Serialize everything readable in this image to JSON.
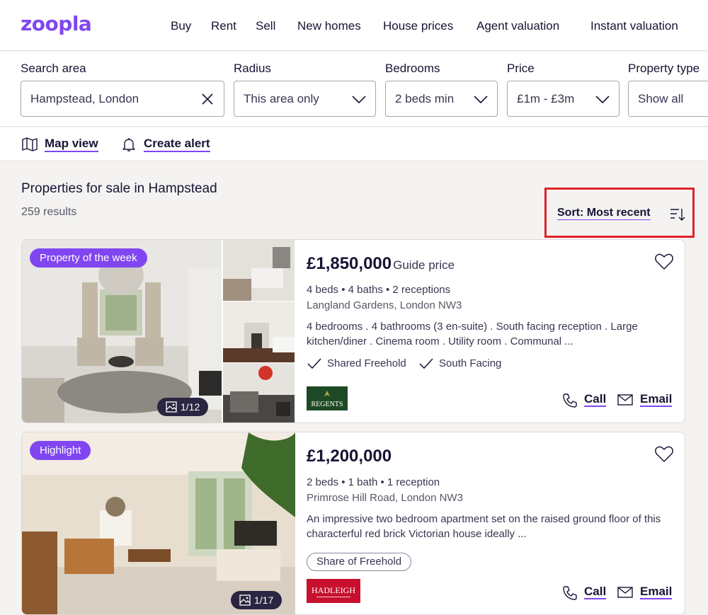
{
  "header": {
    "logo": "ZOOPLA",
    "nav": [
      "Buy",
      "Rent",
      "Sell",
      "New homes",
      "House prices",
      "Agent valuation",
      "Instant valuation"
    ]
  },
  "filters": {
    "search_area": {
      "label": "Search area",
      "value": "Hampstead, London"
    },
    "radius": {
      "label": "Radius",
      "value": "This area only"
    },
    "bedrooms": {
      "label": "Bedrooms",
      "value": "2 beds min"
    },
    "price": {
      "label": "Price",
      "value": "£1m - £3m"
    },
    "property_type": {
      "label": "Property type",
      "value": "Show all"
    }
  },
  "tools": {
    "map_view": "Map view",
    "create_alert": "Create alert"
  },
  "results": {
    "title": "Properties for sale in Hampstead",
    "count": "259 results",
    "sort": "Sort: Most recent"
  },
  "listings": [
    {
      "badge": "Property of the week",
      "image_count": "1/12",
      "price": "£1,850,000",
      "price_qualifier": "Guide price",
      "features": "4 beds • 4 baths • 2 receptions",
      "address": "Langland Gardens, London NW3",
      "description": "4 bedrooms . 4 bathrooms (3 en-suite) . South facing reception . Large kitchen/diner . Cinema room . Utility room . Communal ...",
      "tags": [
        "Shared Freehold",
        "South Facing"
      ],
      "agent": "REGENTS",
      "call": "Call",
      "email": "Email"
    },
    {
      "badge": "Highlight",
      "image_count": "1/17",
      "price": "£1,200,000",
      "features": "2 beds • 1 bath • 1 reception",
      "address": "Primrose Hill Road, London NW3",
      "description": "An impressive two bedroom apartment set on the raised ground floor of this characterful red brick Victorian house ideally ...",
      "pill": "Share of Freehold",
      "agent": "HADLEIGH",
      "call": "Call",
      "email": "Email"
    }
  ],
  "colors": {
    "brand": "#8046f1",
    "highlight_box": "#e0222a"
  }
}
